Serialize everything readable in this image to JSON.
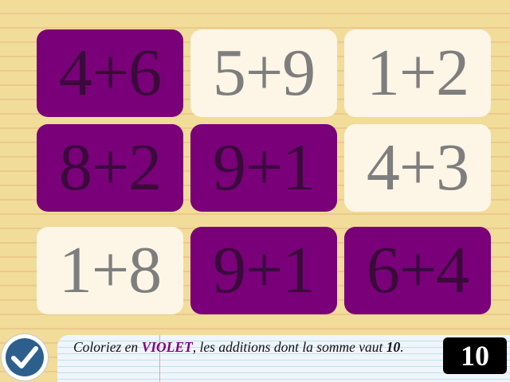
{
  "colors": {
    "violet_tile": "#790079",
    "violet_text": "#3a0a3a",
    "blank_tile": "#fdf6e6",
    "blank_text": "#7e7e7e",
    "accent_word": "#800080"
  },
  "grid": {
    "tiles": [
      {
        "expr": "4+6",
        "state": "violet"
      },
      {
        "expr": "5+9",
        "state": "blank"
      },
      {
        "expr": "1+2",
        "state": "blank"
      },
      {
        "expr": "8+2",
        "state": "violet"
      },
      {
        "expr": "9+1",
        "state": "violet"
      },
      {
        "expr": "4+3",
        "state": "blank"
      },
      {
        "expr": "1+8",
        "state": "blank"
      },
      {
        "expr": "9+1",
        "state": "violet"
      },
      {
        "expr": "6+4",
        "state": "violet"
      }
    ]
  },
  "instruction": {
    "before_color": "Coloriez en ",
    "color_word": "VIOLET",
    "middle": ", les additions dont la somme vaut ",
    "target": "10",
    "after": "."
  },
  "target_box": {
    "value": "10"
  },
  "check_button": {
    "icon": "checkmark-icon"
  }
}
